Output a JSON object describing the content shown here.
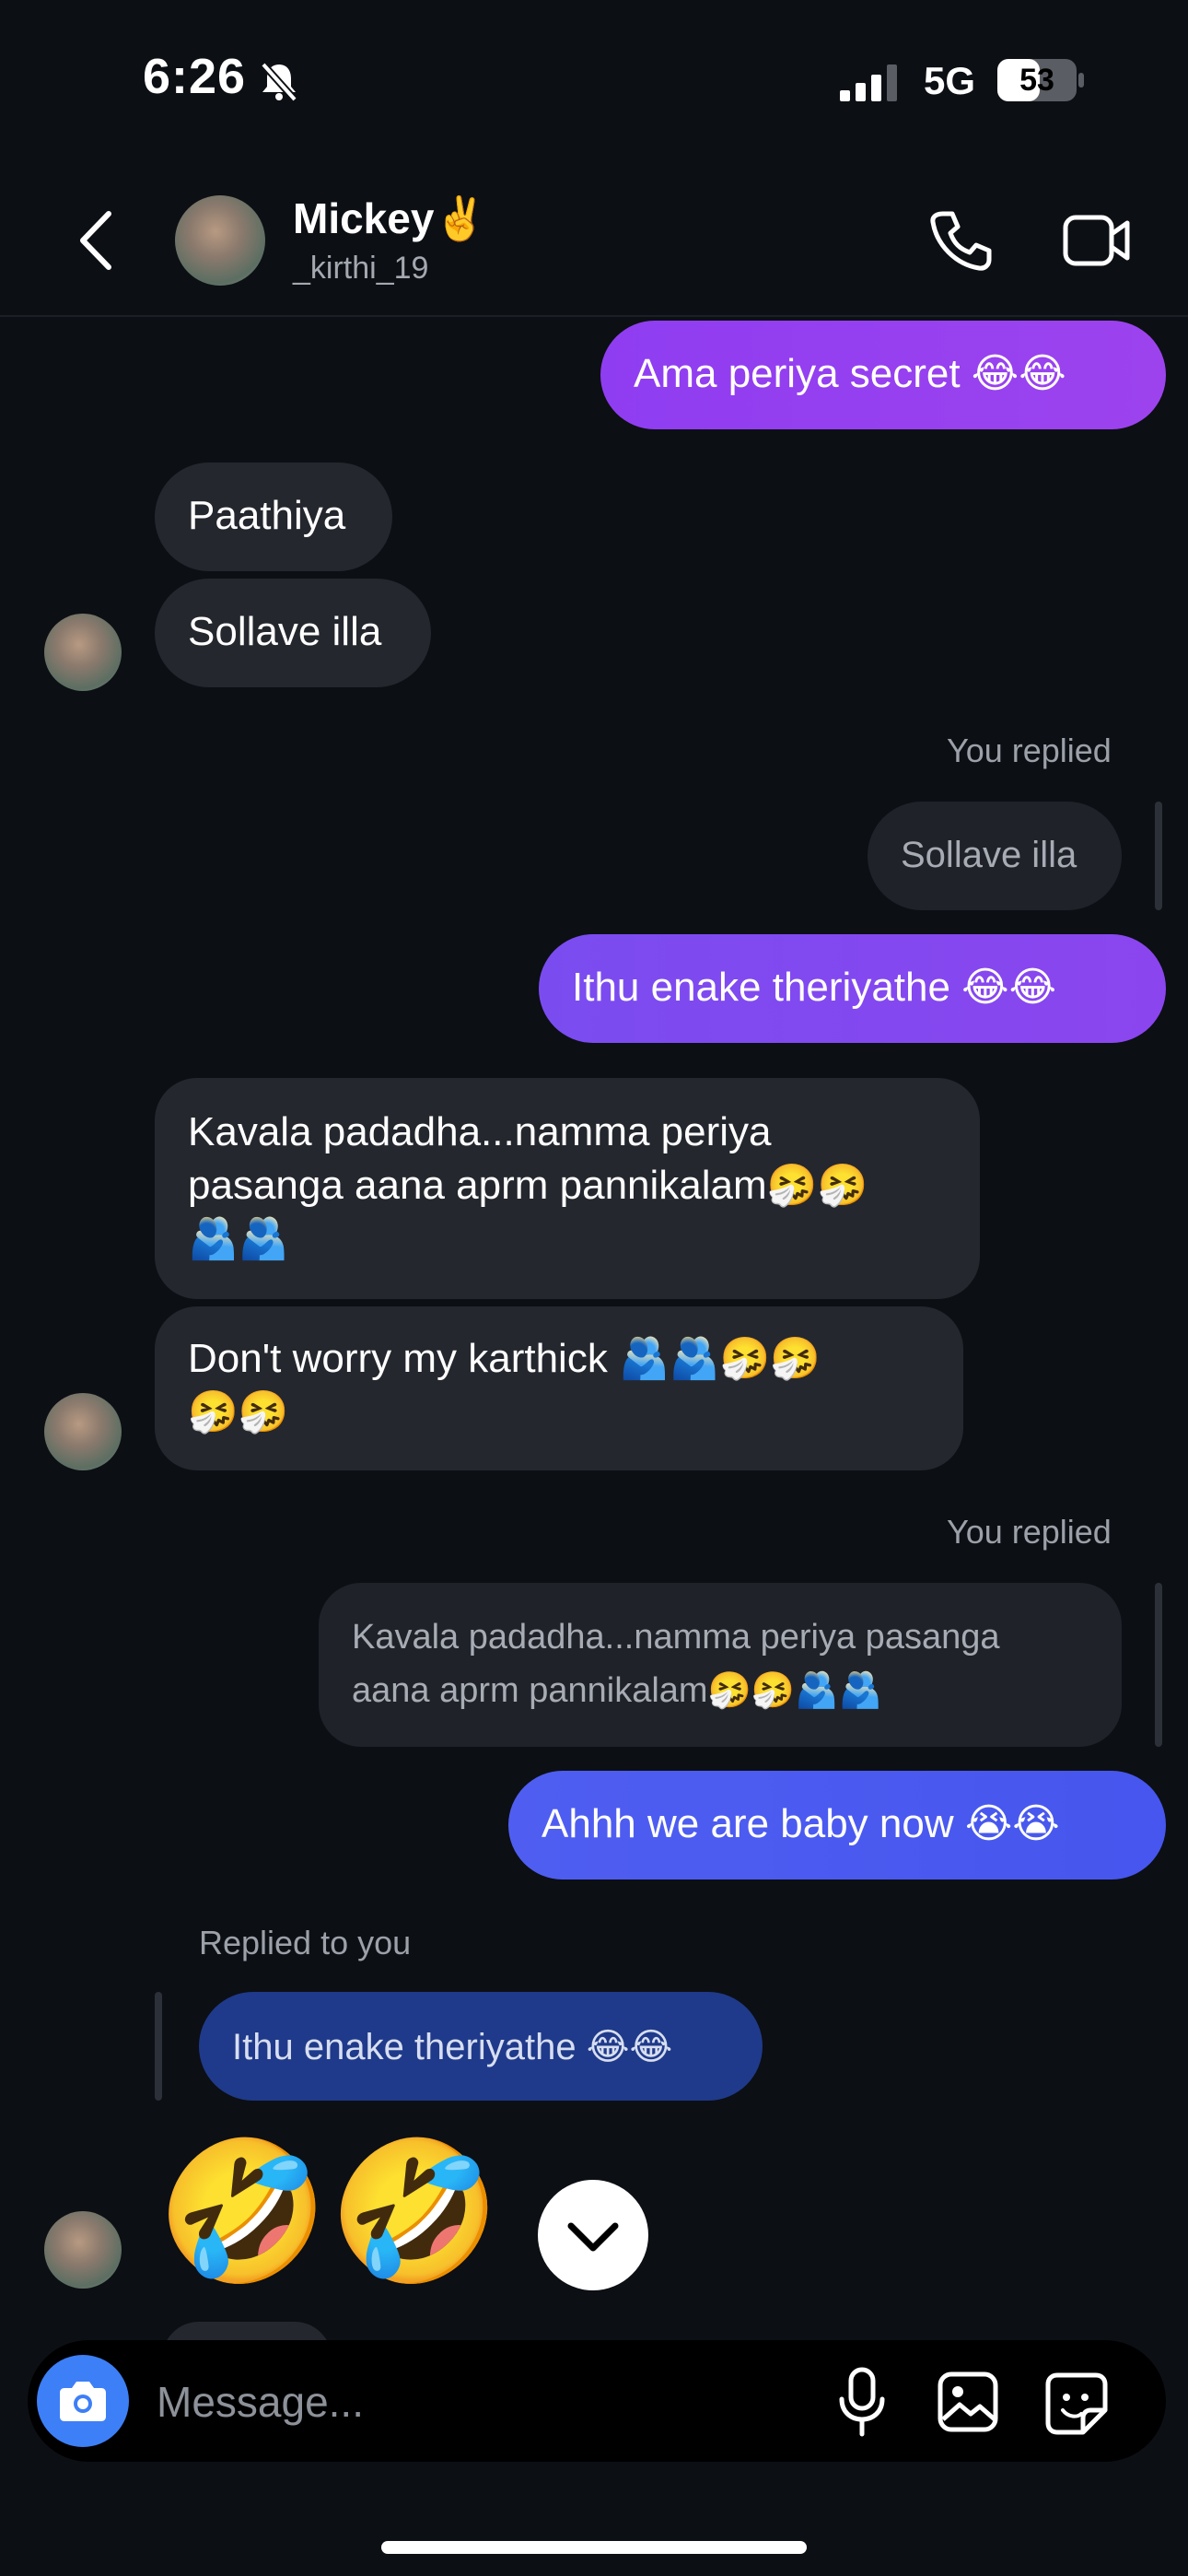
{
  "status_bar": {
    "time": "6:26",
    "network": "5G",
    "battery": "53"
  },
  "header": {
    "name": "Mickey✌️",
    "username": "_kirthi_19"
  },
  "messages": {
    "m1": "Ama periya secret 😂😂",
    "m2": "Paathiya",
    "m3": "Sollave illa",
    "you_replied_1": "You replied",
    "quote1": "Sollave illa",
    "m4": "Ithu enake theriyathe 😂😂",
    "m5_line1": "Kavala padadha...namma periya",
    "m5_line2": "pasanga aana aprm pannikalam🤧🤧",
    "m5_line3": "🫂🫂",
    "m6_line1": "Don't worry my karthick 🫂🫂🤧🤧",
    "m6_line2": "🤧🤧",
    "you_replied_2": "You replied",
    "quote2_line1": "Kavala padadha...namma periya pasanga",
    "quote2_line2": "aana aprm pannikalam🤧🤧🫂🫂",
    "m7": "Ahhh we are baby now 😭😭",
    "replied_to_you": "Replied to you",
    "quote3": "Ithu enake theriyathe 😂😂",
    "m8": "🤣🤣"
  },
  "composer": {
    "placeholder": "Message..."
  },
  "icons": {
    "camera": "camera-icon",
    "mic": "microphone-icon",
    "gallery": "gallery-icon",
    "sticker": "sticker-icon",
    "call": "phone-icon",
    "video": "video-camera-icon",
    "back": "back-chevron-icon",
    "scroll": "chevron-down-icon"
  },
  "colors": {
    "sent_purple": "#9c43ee",
    "sent_blue": "#4656ee",
    "received": "#24272e",
    "background": "#0c0f14",
    "camera_blue": "#3d7ff6"
  }
}
